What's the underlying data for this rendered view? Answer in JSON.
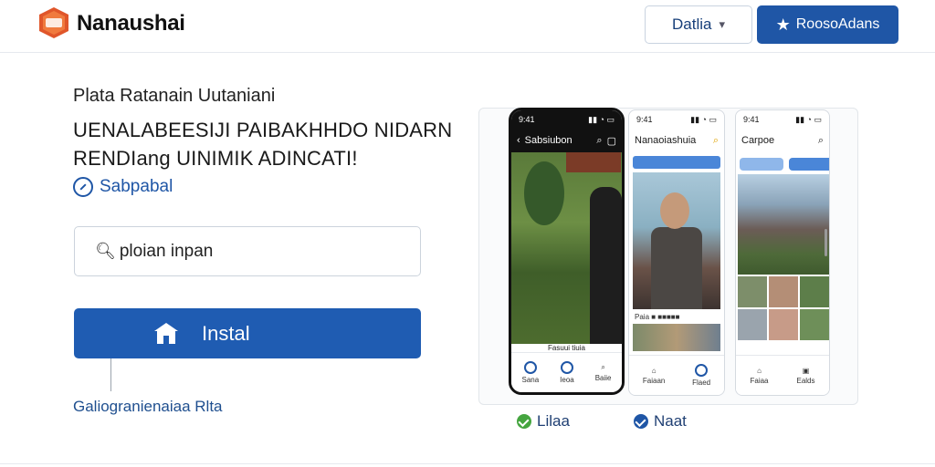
{
  "header": {
    "brand": "Nanaushai",
    "language_label": "Datlia",
    "primary_label": "RoosoAdans"
  },
  "hero": {
    "subtitle": "Plata Ratanain Uutaniani",
    "title_line1": "UENALABEESIJI PAIBAKHHDO NIDARN",
    "title_line2": "RENDIang UINIMIK ADINCATI!",
    "rating_text": "Sabpabal"
  },
  "search": {
    "value": "ploian inpan"
  },
  "install": {
    "label": "Instal"
  },
  "footnote": "Galiogranienaiaa Rlta",
  "phones": {
    "dark": {
      "title": "Sabsiubon",
      "caption": "Fasuui tiuia",
      "nav": [
        "Sana",
        "Ieoa",
        "Baiie"
      ]
    },
    "mid": {
      "title": "Nanaoiashuia",
      "meta": "Paia ■ ■■■■■",
      "nav": [
        "Faiaan",
        "Flaed"
      ]
    },
    "side": {
      "title": "Carpoe",
      "nav": [
        "Faiaa",
        "Ealds"
      ]
    }
  },
  "tags": {
    "green": "Lilaa",
    "blue": "Naat"
  },
  "colors": {
    "primary": "#1f56a6",
    "install": "#1f5cb2",
    "logo": "#e0562a",
    "check_green": "#45a53f"
  }
}
